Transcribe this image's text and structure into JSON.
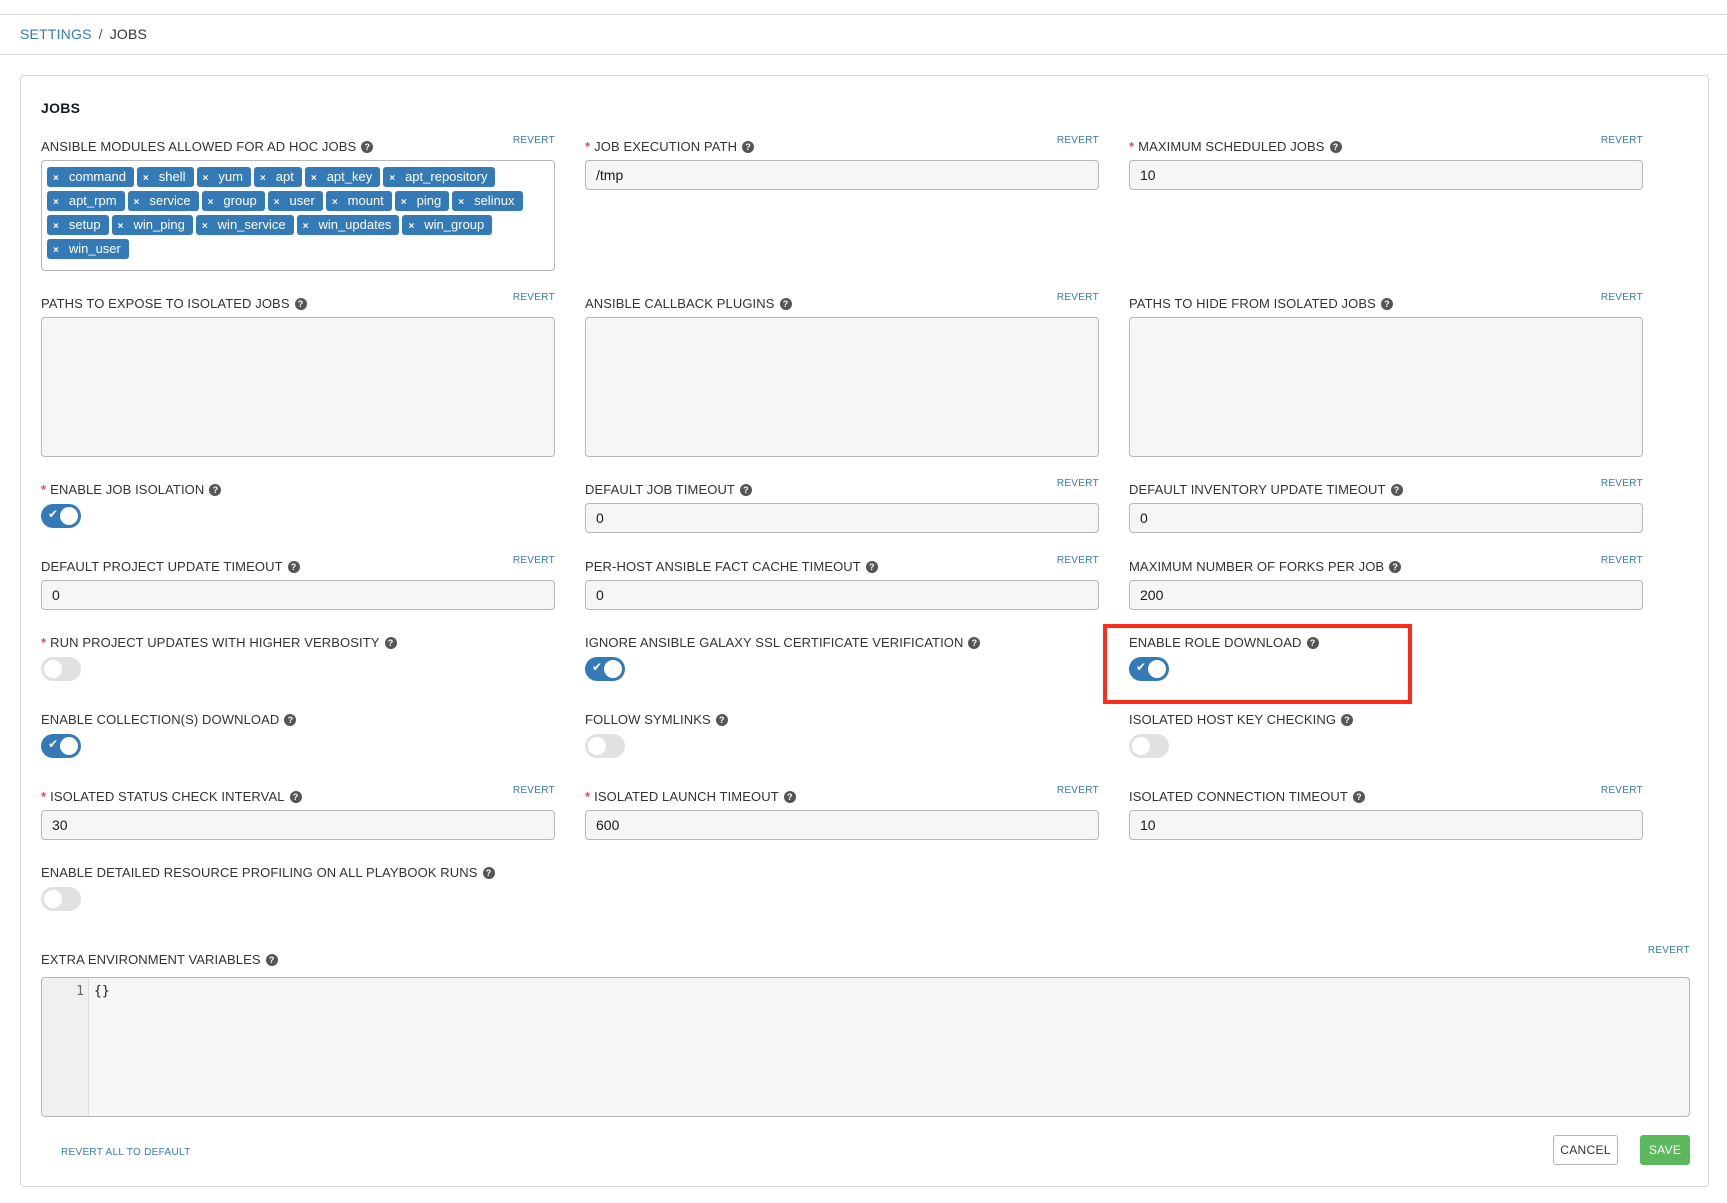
{
  "breadcrumb": {
    "settings": "SETTINGS",
    "separator": "/",
    "current": "JOBS"
  },
  "panel": {
    "title": "JOBS"
  },
  "common": {
    "revert": "REVERT",
    "help": "?"
  },
  "fields": {
    "ansible_modules": {
      "label": "ANSIBLE MODULES ALLOWED FOR AD HOC JOBS",
      "tags": [
        "command",
        "shell",
        "yum",
        "apt",
        "apt_key",
        "apt_repository",
        "apt_rpm",
        "service",
        "group",
        "user",
        "mount",
        "ping",
        "selinux",
        "setup",
        "win_ping",
        "win_service",
        "win_updates",
        "win_group",
        "win_user"
      ]
    },
    "job_execution_path": {
      "label": "JOB EXECUTION PATH",
      "value": "/tmp"
    },
    "max_scheduled_jobs": {
      "label": "MAXIMUM SCHEDULED JOBS",
      "value": "10"
    },
    "paths_expose": {
      "label": "PATHS TO EXPOSE TO ISOLATED JOBS"
    },
    "callback_plugins": {
      "label": "ANSIBLE CALLBACK PLUGINS"
    },
    "paths_hide": {
      "label": "PATHS TO HIDE FROM ISOLATED JOBS"
    },
    "enable_job_isolation": {
      "label": "ENABLE JOB ISOLATION",
      "on": true
    },
    "default_job_timeout": {
      "label": "DEFAULT JOB TIMEOUT",
      "value": "0"
    },
    "default_inventory_timeout": {
      "label": "DEFAULT INVENTORY UPDATE TIMEOUT",
      "value": "0"
    },
    "default_project_timeout": {
      "label": "DEFAULT PROJECT UPDATE TIMEOUT",
      "value": "0"
    },
    "fact_cache_timeout": {
      "label": "PER-HOST ANSIBLE FACT CACHE TIMEOUT",
      "value": "0"
    },
    "max_forks": {
      "label": "MAXIMUM NUMBER OF FORKS PER JOB",
      "value": "200"
    },
    "run_verbosity": {
      "label": "RUN PROJECT UPDATES WITH HIGHER VERBOSITY",
      "on": false
    },
    "ignore_galaxy_ssl": {
      "label": "IGNORE ANSIBLE GALAXY SSL CERTIFICATE VERIFICATION",
      "on": true
    },
    "enable_role_download": {
      "label": "ENABLE ROLE DOWNLOAD",
      "on": true
    },
    "enable_collection_download": {
      "label": "ENABLE COLLECTION(S) DOWNLOAD",
      "on": true
    },
    "follow_symlinks": {
      "label": "FOLLOW SYMLINKS",
      "on": false
    },
    "isolated_host_key": {
      "label": "ISOLATED HOST KEY CHECKING",
      "on": false
    },
    "isolated_status_interval": {
      "label": "ISOLATED STATUS CHECK INTERVAL",
      "value": "30"
    },
    "isolated_launch_timeout": {
      "label": "ISOLATED LAUNCH TIMEOUT",
      "value": "600"
    },
    "isolated_connection_timeout": {
      "label": "ISOLATED CONNECTION TIMEOUT",
      "value": "10"
    },
    "resource_profiling": {
      "label": "ENABLE DETAILED RESOURCE PROFILING ON ALL PLAYBOOK RUNS",
      "on": false
    },
    "extra_env": {
      "label": "EXTRA ENVIRONMENT VARIABLES",
      "line_number": "1",
      "code": "{}"
    }
  },
  "actions": {
    "revert_all": "REVERT ALL TO DEFAULT",
    "cancel": "CANCEL",
    "save": "SAVE"
  },
  "colors": {
    "primary": "#337ab7",
    "success": "#5cb85c",
    "required": "#d9534f",
    "highlight": "#ff2a17"
  },
  "icons": {
    "help": "question-circle-icon",
    "tag_remove": "close-icon",
    "toggle_check": "check-icon"
  }
}
